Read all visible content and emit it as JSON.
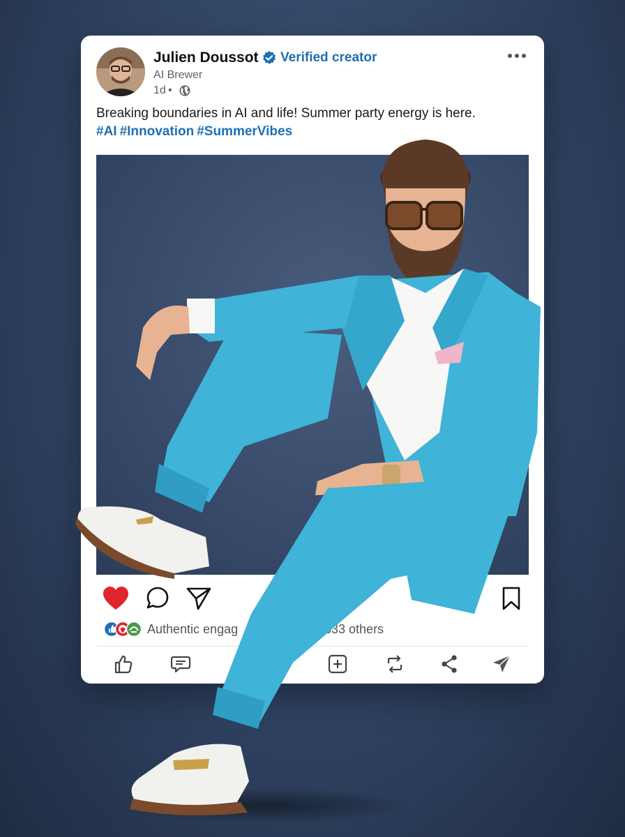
{
  "post": {
    "author_name": "Julien Doussot",
    "verified_label": "Verified creator",
    "author_title": "AI Brewer",
    "time": "1d",
    "time_separator": "•",
    "text": "Breaking boundaries in AI and life! Summer party energy is here.",
    "hashtags": [
      "#AI",
      "#Innovation",
      "#SummerVibes"
    ],
    "reactions_text": "Authentic engag",
    "reactions_others": "333 others"
  },
  "colors": {
    "accent": "#1f6fb2",
    "like": "#e0262b",
    "suit": "#3fb3d8",
    "background": "#2f4261"
  },
  "icons": {
    "primary_actions": [
      "heart-icon",
      "comment-icon",
      "share-send-icon",
      "bookmark-icon"
    ],
    "bottom_bar": [
      "like-thumb-icon",
      "comment-bubble-icon",
      "add-icon",
      "repost-icon",
      "share-icon",
      "send-icon"
    ]
  }
}
